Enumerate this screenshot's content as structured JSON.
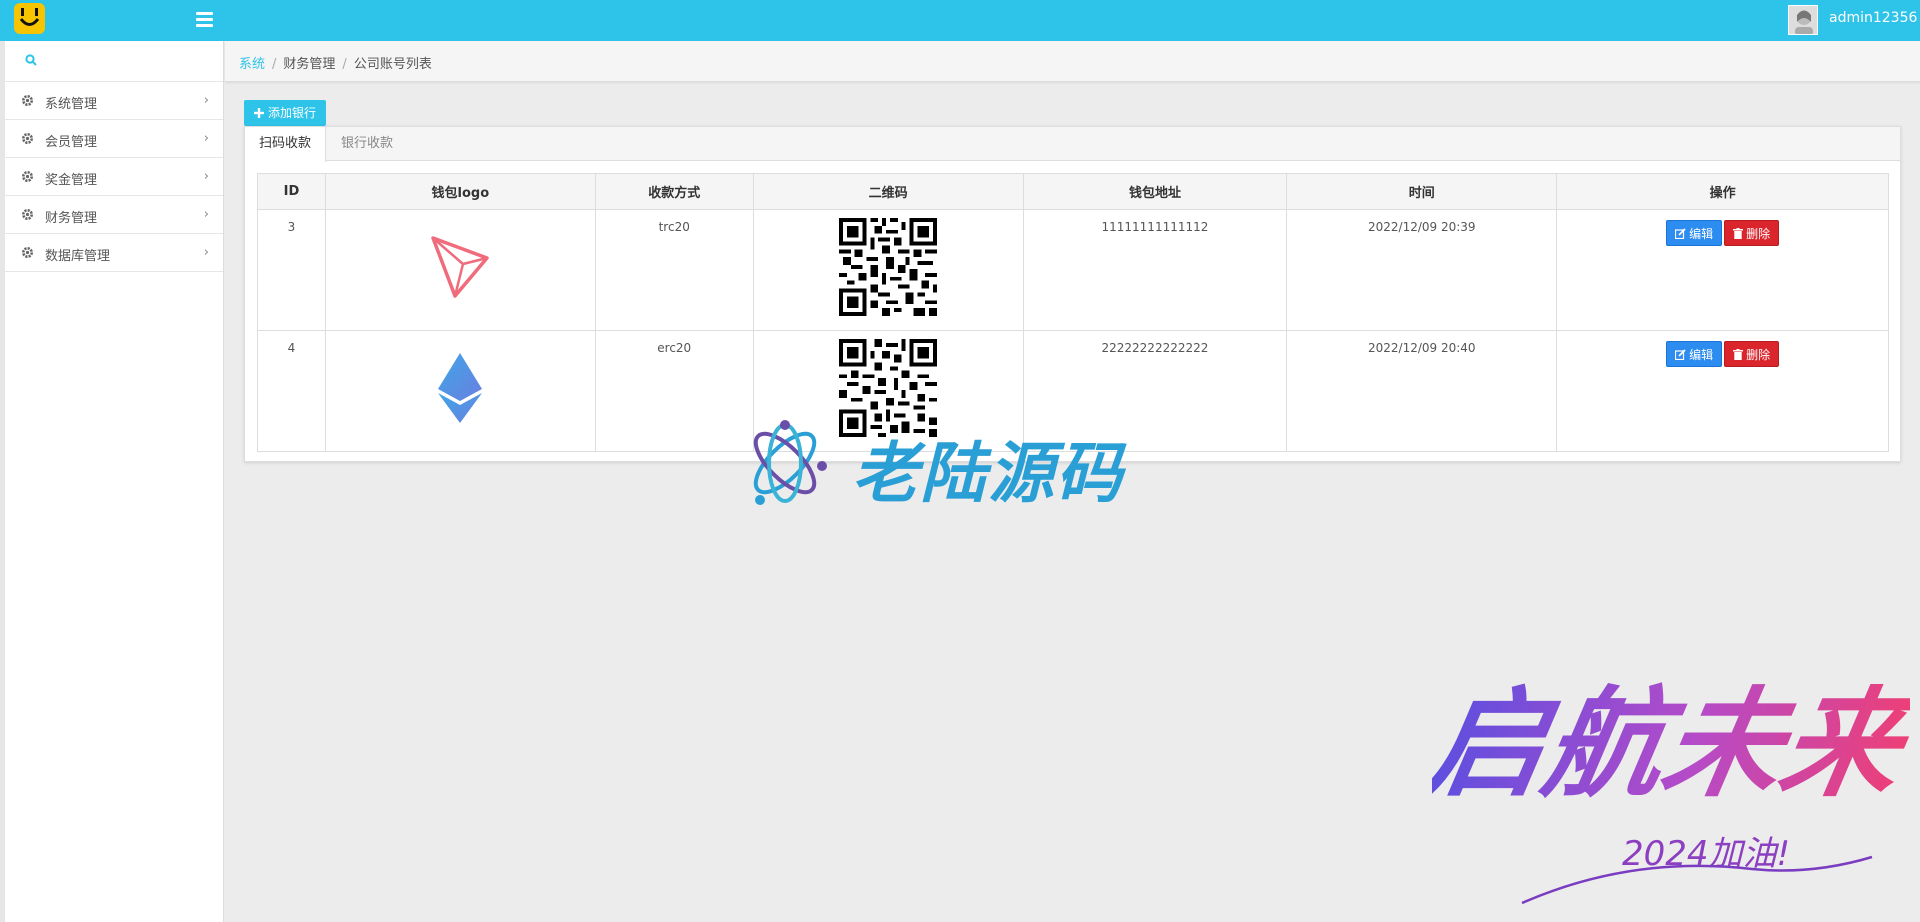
{
  "header": {
    "user_name": "admin12356"
  },
  "sidebar": {
    "search_placeholder": "",
    "items": [
      {
        "label": "系统管理"
      },
      {
        "label": "会员管理"
      },
      {
        "label": "奖金管理"
      },
      {
        "label": "财务管理"
      },
      {
        "label": "数据库管理"
      }
    ]
  },
  "breadcrumb": {
    "items": [
      "系统",
      "财务管理",
      "公司账号列表"
    ],
    "separator": "/"
  },
  "toolbar": {
    "add_label": "添加银行"
  },
  "tabs": [
    {
      "label": "扫码收款",
      "active": true
    },
    {
      "label": "银行收款",
      "active": false
    }
  ],
  "table": {
    "columns": [
      "ID",
      "钱包logo",
      "收款方式",
      "二维码",
      "钱包地址",
      "时间",
      "操作"
    ],
    "rows": [
      {
        "id": "3",
        "logo": "tron-logo",
        "method": "trc20",
        "address": "11111111111112",
        "time": "2022/12/09 20:39"
      },
      {
        "id": "4",
        "logo": "ethereum-logo",
        "method": "erc20",
        "address": "22222222222222",
        "time": "2022/12/09 20:40"
      }
    ],
    "edit_label": "编辑",
    "delete_label": "删除"
  },
  "watermark": {
    "text": "老陆源码"
  },
  "promo": {
    "title": "启航未来",
    "subtitle": "2024加油!"
  },
  "colors": {
    "accent": "#2ec3e8",
    "edit": "#2d8cf0",
    "delete": "#d9252b"
  }
}
